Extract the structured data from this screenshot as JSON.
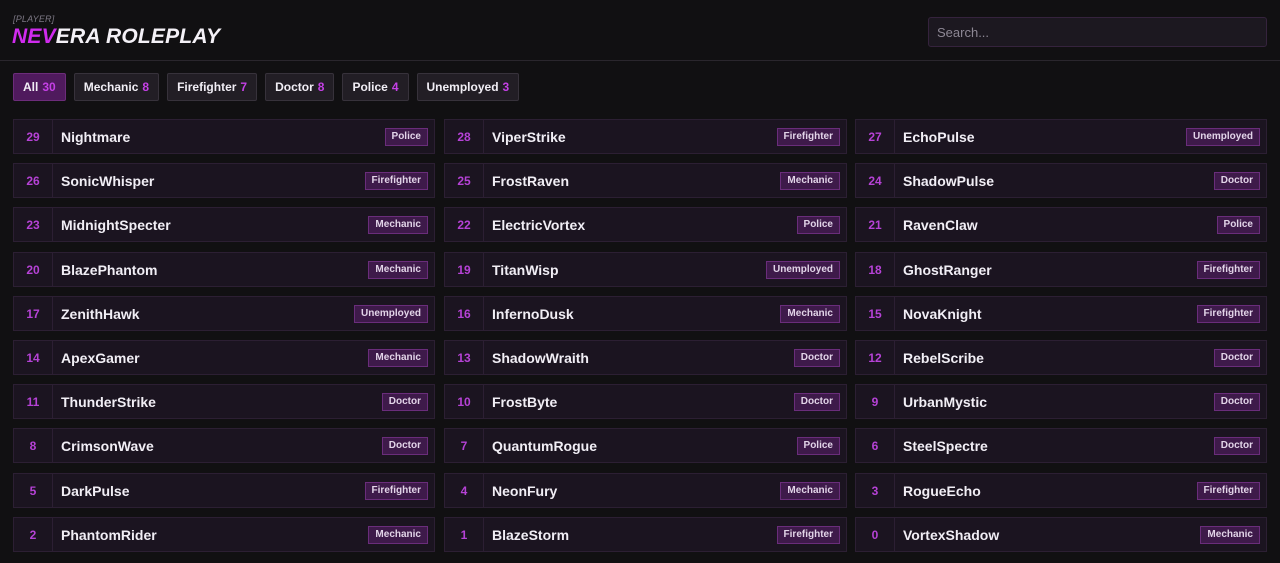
{
  "header": {
    "tag": "[PLAYER]",
    "logo_accent": "NEV",
    "logo_rest": "ERA ROLEPLAY",
    "search_placeholder": "Search..."
  },
  "colors": {
    "accent": "#d02bee",
    "background": "#111012",
    "card": "#1b1420",
    "badge": "#3e1a4a"
  },
  "filters": [
    {
      "label": "All",
      "count": "30",
      "active": true
    },
    {
      "label": "Mechanic",
      "count": "8"
    },
    {
      "label": "Firefighter",
      "count": "7"
    },
    {
      "label": "Doctor",
      "count": "8"
    },
    {
      "label": "Police",
      "count": "4"
    },
    {
      "label": "Unemployed",
      "count": "3"
    }
  ],
  "players": [
    {
      "id": "29",
      "name": "Nightmare",
      "job": "Police"
    },
    {
      "id": "28",
      "name": "ViperStrike",
      "job": "Firefighter"
    },
    {
      "id": "27",
      "name": "EchoPulse",
      "job": "Unemployed"
    },
    {
      "id": "26",
      "name": "SonicWhisper",
      "job": "Firefighter"
    },
    {
      "id": "25",
      "name": "FrostRaven",
      "job": "Mechanic"
    },
    {
      "id": "24",
      "name": "ShadowPulse",
      "job": "Doctor"
    },
    {
      "id": "23",
      "name": "MidnightSpecter",
      "job": "Mechanic"
    },
    {
      "id": "22",
      "name": "ElectricVortex",
      "job": "Police"
    },
    {
      "id": "21",
      "name": "RavenClaw",
      "job": "Police"
    },
    {
      "id": "20",
      "name": "BlazePhantom",
      "job": "Mechanic"
    },
    {
      "id": "19",
      "name": "TitanWisp",
      "job": "Unemployed"
    },
    {
      "id": "18",
      "name": "GhostRanger",
      "job": "Firefighter"
    },
    {
      "id": "17",
      "name": "ZenithHawk",
      "job": "Unemployed"
    },
    {
      "id": "16",
      "name": "InfernoDusk",
      "job": "Mechanic"
    },
    {
      "id": "15",
      "name": "NovaKnight",
      "job": "Firefighter"
    },
    {
      "id": "14",
      "name": "ApexGamer",
      "job": "Mechanic"
    },
    {
      "id": "13",
      "name": "ShadowWraith",
      "job": "Doctor"
    },
    {
      "id": "12",
      "name": "RebelScribe",
      "job": "Doctor"
    },
    {
      "id": "11",
      "name": "ThunderStrike",
      "job": "Doctor"
    },
    {
      "id": "10",
      "name": "FrostByte",
      "job": "Doctor"
    },
    {
      "id": "9",
      "name": "UrbanMystic",
      "job": "Doctor"
    },
    {
      "id": "8",
      "name": "CrimsonWave",
      "job": "Doctor"
    },
    {
      "id": "7",
      "name": "QuantumRogue",
      "job": "Police"
    },
    {
      "id": "6",
      "name": "SteelSpectre",
      "job": "Doctor"
    },
    {
      "id": "5",
      "name": "DarkPulse",
      "job": "Firefighter"
    },
    {
      "id": "4",
      "name": "NeonFury",
      "job": "Mechanic"
    },
    {
      "id": "3",
      "name": "RogueEcho",
      "job": "Firefighter"
    },
    {
      "id": "2",
      "name": "PhantomRider",
      "job": "Mechanic"
    },
    {
      "id": "1",
      "name": "BlazeStorm",
      "job": "Firefighter"
    },
    {
      "id": "0",
      "name": "VortexShadow",
      "job": "Mechanic"
    }
  ]
}
